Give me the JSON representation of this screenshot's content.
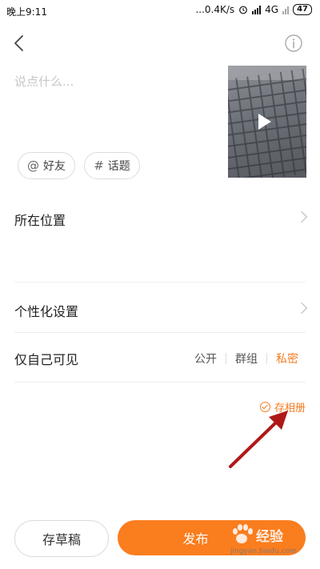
{
  "status_bar": {
    "time": "晚上9:11",
    "network_speed": "...0.4K/s",
    "network_type": "4G",
    "battery": "47"
  },
  "compose": {
    "placeholder": "说点什么...",
    "chips": [
      {
        "icon": "at-icon",
        "symbol": "@",
        "label": "好友"
      },
      {
        "icon": "hash-icon",
        "symbol": "#",
        "label": "话题"
      }
    ]
  },
  "settings": {
    "location_label": "所在位置",
    "personalize_label": "个性化设置",
    "visibility_label": "仅自己可见",
    "visibility_options": [
      "公开",
      "群组",
      "私密"
    ],
    "visibility_selected": "私密"
  },
  "save_album_label": "存相册",
  "footer": {
    "draft_label": "存草稿",
    "publish_label": "发布"
  },
  "watermark": {
    "text": "经验",
    "url": "jingyan.baidu.com"
  },
  "colors": {
    "accent": "#f57c1f",
    "publish_bg": "#fa7d1e",
    "arrow": "#b01818"
  }
}
